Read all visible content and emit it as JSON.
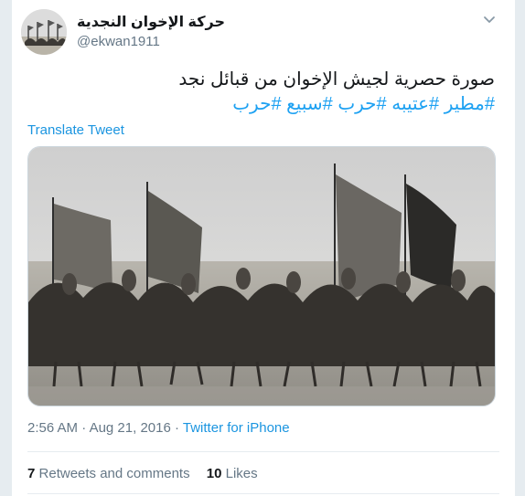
{
  "tweet": {
    "display_name": "حركة الإخوان النجدية",
    "handle": "@ekwan1911",
    "text_line": "صورة حصرية لجيش الإخوان من قبائل نجد",
    "hashtags": [
      "#مطير",
      "#عتيبه",
      "#حرب",
      "#سبيع",
      "#حرب"
    ],
    "translate_label": "Translate Tweet",
    "time": "2:56 AM",
    "date": "Aug 21, 2016",
    "separator": "·",
    "via": "Twitter for iPhone",
    "retweets_count": "7",
    "retweets_label": "Retweets and comments",
    "likes_count": "10",
    "likes_label": "Likes"
  },
  "icons": {
    "caret": "chevron-down-icon",
    "avatar": "avatar"
  },
  "colors": {
    "link": "#1da1f2",
    "secondary_text": "#657786",
    "primary_text": "#14171a",
    "border": "#e6ecf0"
  }
}
